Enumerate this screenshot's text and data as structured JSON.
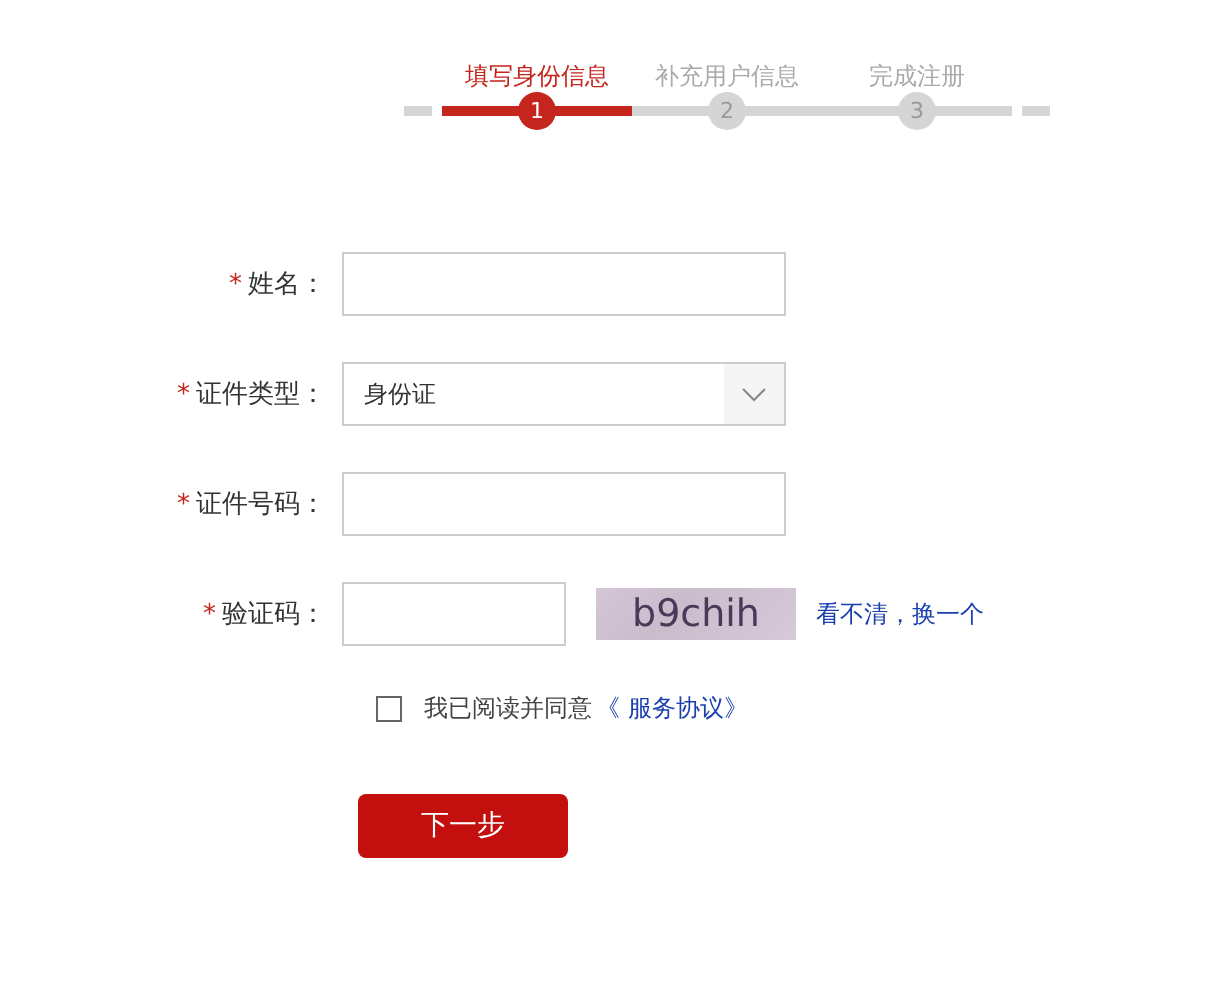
{
  "steps": [
    {
      "label": "填写身份信息",
      "number": "1",
      "selected": true
    },
    {
      "label": "补充用户信息",
      "number": "2",
      "selected": false
    },
    {
      "label": "完成注册",
      "number": "3",
      "selected": false
    }
  ],
  "fields": [
    {
      "kind": "text",
      "required_mark": "*",
      "label": "姓名："
    },
    {
      "kind": "select",
      "required_mark": "*",
      "label": "证件类型：",
      "value": "身份证"
    },
    {
      "kind": "text",
      "required_mark": "*",
      "label": "证件号码："
    },
    {
      "kind": "captcha",
      "required_mark": "*",
      "label": "验证码：",
      "captcha": "b9chih",
      "refresh": "看不清，换一个"
    }
  ],
  "agreement": {
    "checked": false,
    "text": "我已阅读并同意",
    "link": "《 服务协议》"
  },
  "submit": "下一步"
}
